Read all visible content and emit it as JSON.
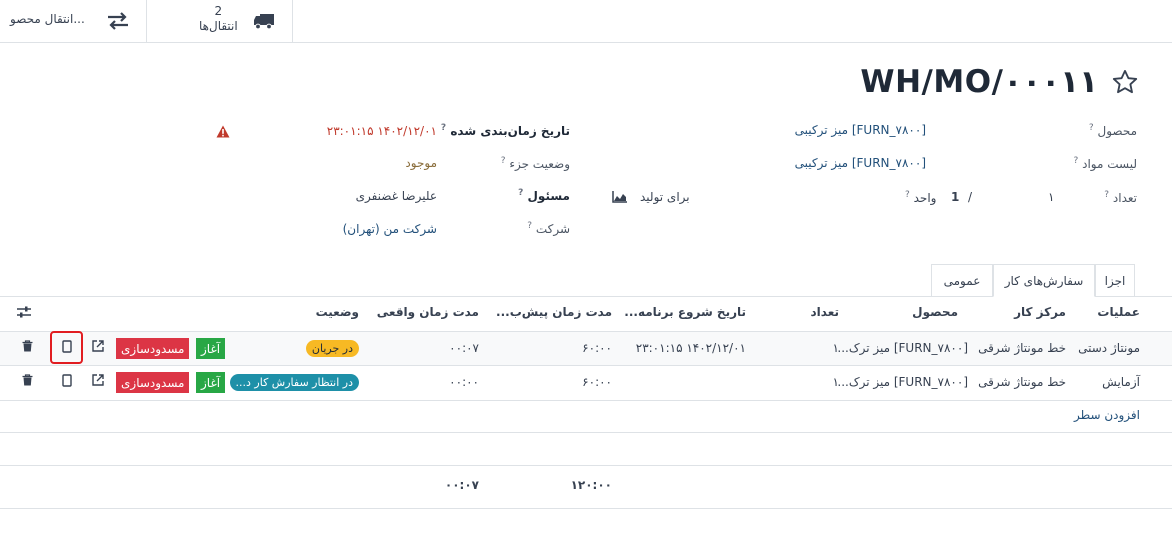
{
  "smart_buttons": {
    "transfers": {
      "label": "انتقال محصو..."
    },
    "deliveries": {
      "count": "2",
      "label": "انتقال‌ها"
    }
  },
  "record": {
    "title": "WH/MO/۰۰۰۱۱"
  },
  "fields": {
    "product": {
      "label": "محصول",
      "value": "[FURN_۷۸۰۰] میز ترکیبی"
    },
    "bom": {
      "label": "لیست مواد",
      "value": "[FURN_۷۸۰۰] میز ترکیبی"
    },
    "quantity": {
      "label": "تعداد",
      "value": "۱",
      "produced": "1",
      "separator": "/",
      "uom": "واحد",
      "to_produce": "برای تولید"
    },
    "scheduled_date": {
      "label": "تاریخ زمان‌بندی شده",
      "value": "۱۴۰۲/۱۲/۰۱ ۲۳:۰۱:۱۵"
    },
    "component_status": {
      "label": "وضعیت جزء",
      "value": "موجود"
    },
    "responsible": {
      "label": "مسئول",
      "value": "علیرضا غضنفری"
    },
    "company": {
      "label": "شرکت",
      "value": "شرکت من (تهران)"
    }
  },
  "tabs": {
    "components": "اجزا",
    "work_orders": "سفارش‌های کار",
    "misc": "عمومی"
  },
  "table": {
    "headers": {
      "operation": "عملیات",
      "workcenter": "مرکز کار",
      "product": "محصول",
      "quantity": "تعداد",
      "start_date": "تاریخ شروع برنامه...",
      "expected_duration": "مدت زمان پیش‌ب...",
      "real_duration": "مدت زمان واقعی",
      "status": "وضعیت"
    },
    "rows": [
      {
        "operation": "مونتاژ دستی",
        "workcenter": "خط مونتاژ شرقی",
        "product": "[FURN_۷۸۰۰] میز ترک...",
        "quantity": "۱",
        "start_date": "۱۴۰۲/۱۲/۰۱ ۲۳:۰۱:۱۵",
        "expected_duration": "۶۰:۰۰",
        "real_duration": "۰۰:۰۷",
        "status": "در جریان",
        "start_label": "آغاز",
        "block_label": "مسدودسازی"
      },
      {
        "operation": "آزمایش",
        "workcenter": "خط مونتاژ شرقی",
        "product": "[FURN_۷۸۰۰] میز ترک...",
        "quantity": "۱",
        "start_date": "",
        "expected_duration": "۶۰:۰۰",
        "real_duration": "۰۰:۰۰",
        "status": "در انتظار سفارش کار د...",
        "start_label": "آغاز",
        "block_label": "مسدودسازی"
      }
    ],
    "add_line": "افزودن سطر",
    "totals": {
      "expected_duration": "۱۲۰:۰۰",
      "real_duration": "۰۰:۰۷"
    }
  },
  "colors": {
    "in_progress": "#f7b924",
    "waiting": "#1e90a8",
    "start": "#28a745",
    "block": "#dc3545",
    "link": "#22507a"
  }
}
